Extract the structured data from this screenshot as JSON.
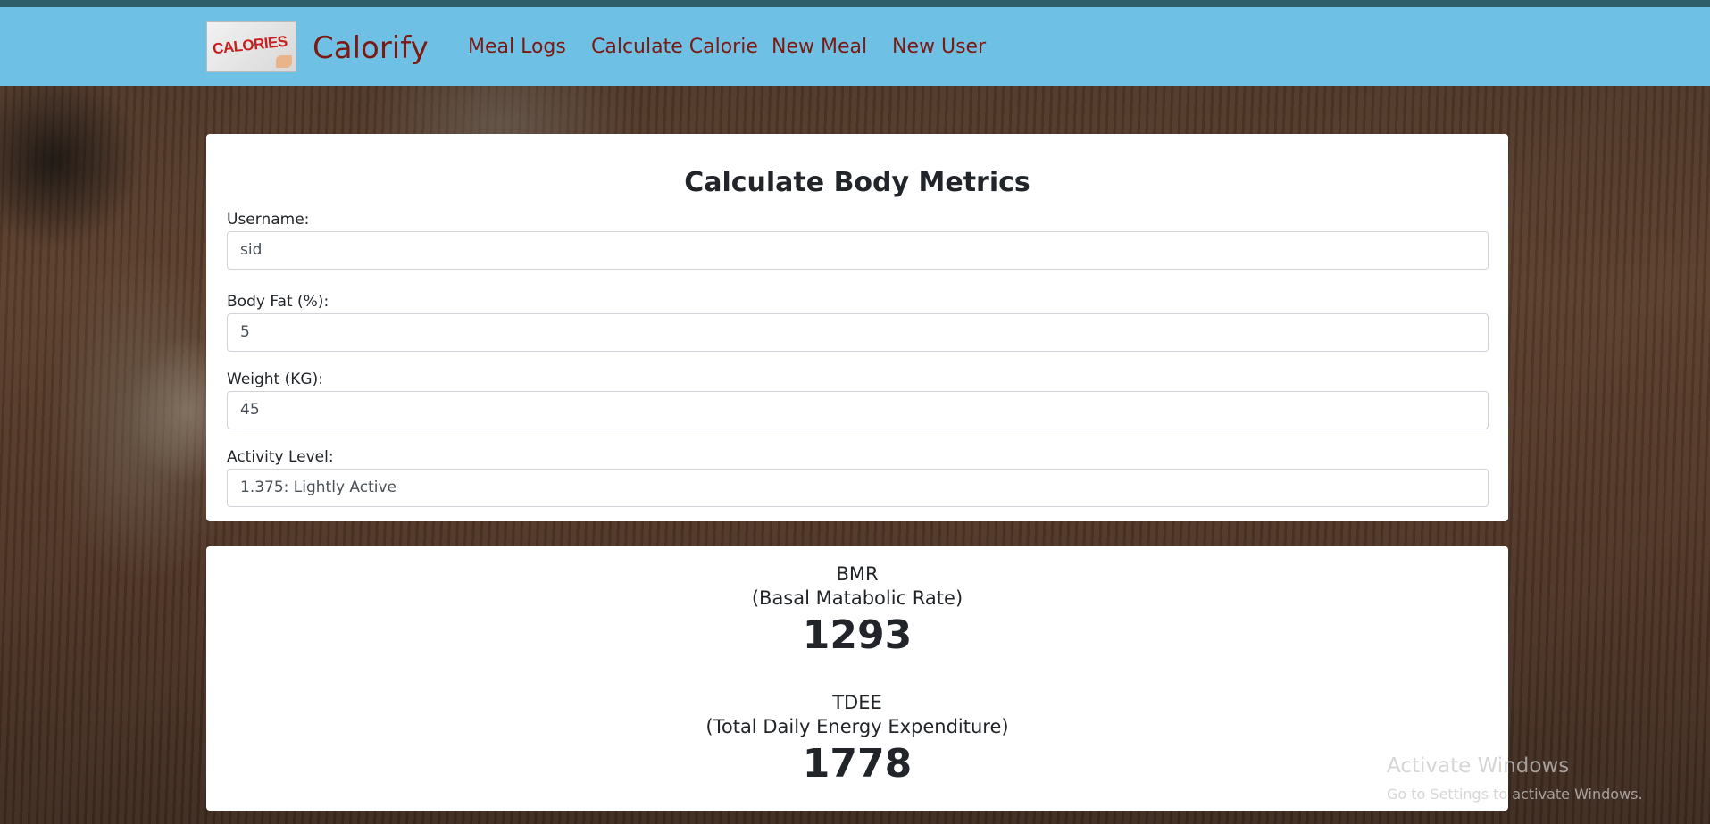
{
  "navbar": {
    "brand_name": "Calorify",
    "logo_text": "CALORIES",
    "links": [
      "Meal Logs",
      "Calculate Calorie",
      "New Meal",
      "New User"
    ]
  },
  "form": {
    "title": "Calculate Body Metrics",
    "username_label": "Username:",
    "username_value": "sid",
    "bodyfat_label": "Body Fat (%):",
    "bodyfat_value": "5",
    "weight_label": "Weight (KG):",
    "weight_value": "45",
    "activity_label": "Activity Level:",
    "activity_value": "1.375: Lightly Active"
  },
  "results": {
    "bmr_title": "BMR",
    "bmr_subtitle": "(Basal Matabolic Rate)",
    "bmr_value": "1293",
    "tdee_title": "TDEE",
    "tdee_subtitle": "(Total Daily Energy Expenditure)",
    "tdee_value": "1778"
  },
  "watermark": {
    "title": "Activate Windows",
    "subtitle": "Go to Settings to activate Windows."
  },
  "colors": {
    "navbar_bg": "#6ec1e4",
    "nav_text": "#7a1a12",
    "card_bg": "#ffffff"
  }
}
